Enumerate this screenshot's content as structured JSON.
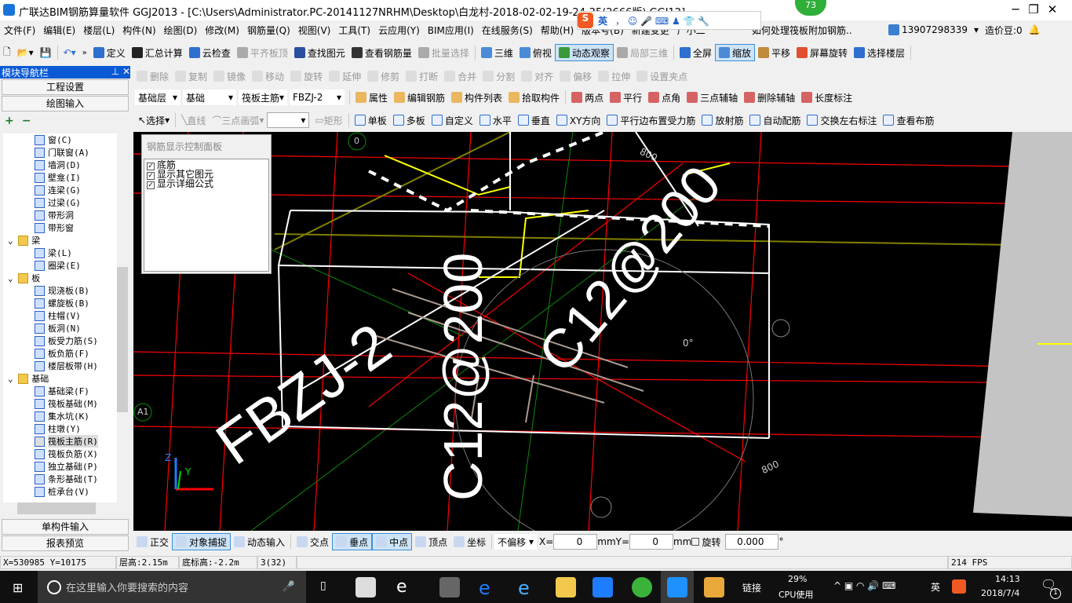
{
  "title": "广联达BIM钢筋算量软件 GGJ2013 - [C:\\Users\\Administrator.PC-20141127NRHM\\Desktop\\白龙村-2018-02-02-19-24-35(2666版).GGJ12]",
  "badge": "73",
  "ime": {
    "mode": "英"
  },
  "menu": [
    "文件(F)",
    "编辑(E)",
    "楼层(L)",
    "构件(N)",
    "绘图(D)",
    "修改(M)",
    "钢筋量(Q)",
    "视图(V)",
    "工具(T)",
    "云应用(Y)",
    "BIM应用(I)",
    "在线服务(S)",
    "帮助(H)",
    "版本号(B)",
    "新建变更",
    "广小二"
  ],
  "menu_right": {
    "question": "如何处理筏板附加钢筋..",
    "phone": "13907298339",
    "beans": "造价豆:0"
  },
  "toolbar1": [
    "定义",
    "汇总计算",
    "云检查",
    "平齐板顶",
    "查找图元",
    "查看钢筋量",
    "批量选择",
    "三维",
    "俯视",
    "动态观察",
    "局部三维",
    "全屏",
    "缩放",
    "平移",
    "屏幕旋转",
    "选择楼层"
  ],
  "toolbar2": [
    "删除",
    "复制",
    "镜像",
    "移动",
    "旋转",
    "延伸",
    "修剪",
    "打断",
    "合并",
    "分割",
    "对齐",
    "偏移",
    "拉伸",
    "设置夹点"
  ],
  "toolbar3": {
    "floor": "基础层",
    "category": "基础",
    "type": "筏板主筋",
    "name": "FBZJ-2",
    "buttons": [
      "属性",
      "编辑钢筋",
      "构件列表",
      "拾取构件",
      "两点",
      "平行",
      "点角",
      "三点辅轴",
      "删除辅轴",
      "长度标注"
    ]
  },
  "toolbar4": {
    "select": "选择",
    "line": "直线",
    "arc": "三点画弧",
    "rect": "矩形",
    "buttons": [
      "单板",
      "多板",
      "自定义",
      "水平",
      "垂直",
      "XY方向",
      "平行边布置受力筋",
      "放射筋",
      "自动配筋",
      "交换左右标注",
      "查看布筋"
    ]
  },
  "nav": {
    "title": "模块导航栏",
    "project": "工程设置",
    "draw": "绘图输入",
    "single": "单构件输入",
    "report": "报表预览"
  },
  "tree": [
    {
      "label": "窗(C)"
    },
    {
      "label": "门联窗(A)"
    },
    {
      "label": "墙洞(D)"
    },
    {
      "label": "壁龛(I)"
    },
    {
      "label": "连梁(G)"
    },
    {
      "label": "过梁(G)"
    },
    {
      "label": "带形洞"
    },
    {
      "label": "带形窗"
    },
    {
      "label": "梁",
      "folder": true
    },
    {
      "label": "梁(L)"
    },
    {
      "label": "圈梁(E)"
    },
    {
      "label": "板",
      "folder": true
    },
    {
      "label": "现浇板(B)"
    },
    {
      "label": "螺旋板(B)"
    },
    {
      "label": "柱帽(V)"
    },
    {
      "label": "板洞(N)"
    },
    {
      "label": "板受力筋(S)"
    },
    {
      "label": "板负筋(F)"
    },
    {
      "label": "楼层板带(H)"
    },
    {
      "label": "基础",
      "folder": true
    },
    {
      "label": "基础梁(F)"
    },
    {
      "label": "筏板基础(M)"
    },
    {
      "label": "集水坑(K)"
    },
    {
      "label": "柱墩(Y)"
    },
    {
      "label": "筏板主筋(R)",
      "selected": true
    },
    {
      "label": "筏板负筋(X)"
    },
    {
      "label": "独立基础(P)"
    },
    {
      "label": "条形基础(T)"
    },
    {
      "label": "桩承台(V)"
    }
  ],
  "panel": {
    "title": "钢筋显示控制面板",
    "options": [
      {
        "label": "底筋",
        "checked": true
      },
      {
        "label": "显示其它图元",
        "checked": true
      },
      {
        "label": "显示详细公式",
        "checked": true
      }
    ]
  },
  "viewport": {
    "labels": {
      "rebar1": "FBZJ-2",
      "rebar2": "C12@200",
      "rebar3": "C12@200",
      "dim1": "800",
      "dim2": "800",
      "angle": "0°",
      "axis_a1": "A1",
      "axis_0": "0",
      "z": "Z",
      "y": "Y"
    }
  },
  "bottom": {
    "buttons": [
      "正交",
      "对象捕捉",
      "动态输入",
      "交点",
      "垂点",
      "中点",
      "顶点",
      "坐标"
    ],
    "offset": "不偏移",
    "x_label": "X=",
    "x": "0",
    "y_label": "Y=",
    "y": "0",
    "unit": "mm",
    "rotate": "旋转",
    "angle": "0.000",
    "deg": "°"
  },
  "status": {
    "coords": "X=530985 Y=10175",
    "floor_height": "层高:2.15m",
    "base_elev": "底标高:-2.2m",
    "count": "3(32)",
    "fps": "214 FPS"
  },
  "taskbar": {
    "search": "在这里输入你要搜索的内容",
    "link": "链接",
    "cpu": "29%",
    "cpu_label": "CPU使用",
    "lang": "英",
    "time": "14:13",
    "date": "2018/7/4",
    "notif": "1"
  },
  "colors": {
    "nav_header": "#0a5ad6",
    "viewport": "#000000",
    "axis_red": "#ff0000",
    "rebar_white": "#ffffff",
    "yellow": "#ffff00"
  }
}
